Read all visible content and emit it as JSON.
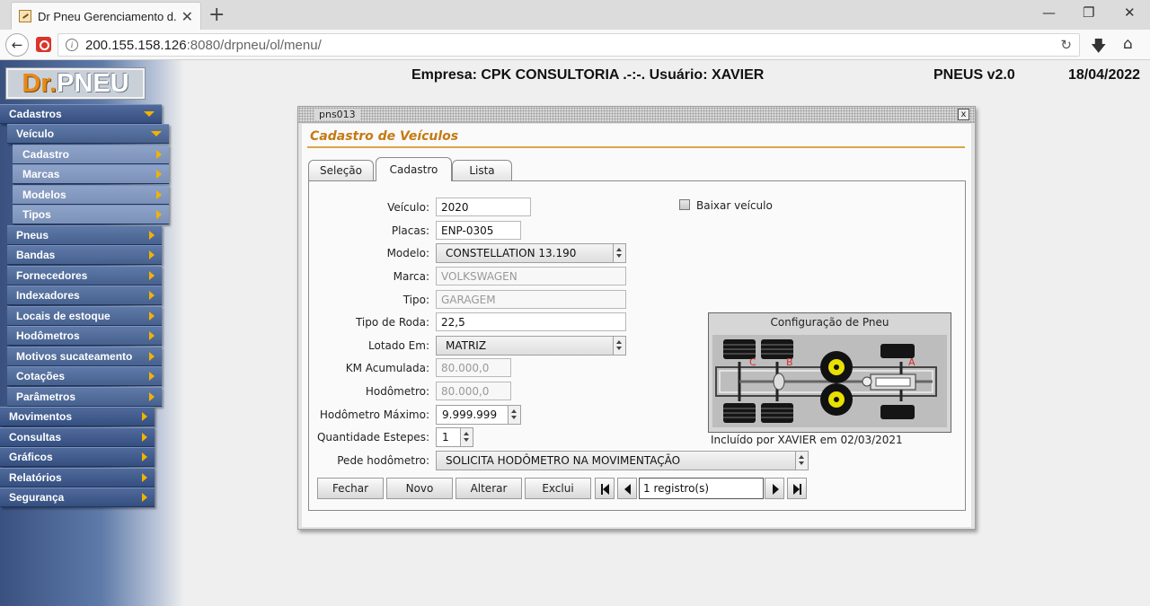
{
  "browser": {
    "tab_title": "Dr Pneu Gerenciamento d...",
    "tab_close": "✕",
    "new_tab": "+",
    "url_host": "200.155.158.126",
    "url_rest": ":8080/drpneu/ol/menu/",
    "window_controls": [
      "—",
      "❐",
      "✕"
    ]
  },
  "header": {
    "logo_dr": "Dr.",
    "logo_pneu": "PNEU",
    "company_user": "Empresa: CPK CONSULTORIA .-:-. Usuário: XAVIER",
    "version": "PNEUS v2.0",
    "date": "18/04/2022"
  },
  "menu": {
    "items": [
      {
        "label": "Cadastros",
        "level": 1,
        "expanded": true
      },
      {
        "label": "Veículo",
        "level": 2,
        "expanded": true
      },
      {
        "label": "Cadastro",
        "level": 3
      },
      {
        "label": "Marcas",
        "level": 3
      },
      {
        "label": "Modelos",
        "level": 3
      },
      {
        "label": "Tipos",
        "level": 3
      },
      {
        "label": "Pneus",
        "level": 2
      },
      {
        "label": "Bandas",
        "level": 2
      },
      {
        "label": "Fornecedores",
        "level": 2
      },
      {
        "label": "Indexadores",
        "level": 2
      },
      {
        "label": "Locais de estoque",
        "level": 2
      },
      {
        "label": "Hodômetros",
        "level": 2
      },
      {
        "label": "Motivos sucateamento",
        "level": 2
      },
      {
        "label": "Cotações",
        "level": 2
      },
      {
        "label": "Parâmetros",
        "level": 2
      },
      {
        "label": "Movimentos",
        "level": 1
      },
      {
        "label": "Consultas",
        "level": 1
      },
      {
        "label": "Gráficos",
        "level": 1
      },
      {
        "label": "Relatórios",
        "level": 1
      },
      {
        "label": "Segurança",
        "level": 1
      }
    ]
  },
  "window": {
    "id": "pns013",
    "close": "x",
    "title": "Cadastro de Veículos",
    "tabs": [
      "Seleção",
      "Cadastro",
      "Lista"
    ],
    "active_tab": "Cadastro"
  },
  "form": {
    "veiculo_label": "Veículo:",
    "veiculo": "2020",
    "placas_label": "Placas:",
    "placas": "ENP-0305",
    "modelo_label": "Modelo:",
    "modelo": "CONSTELLATION 13.190",
    "marca_label": "Marca:",
    "marca": "VOLKSWAGEN",
    "tipo_label": "Tipo:",
    "tipo": "GARAGEM",
    "tipo_roda_label": "Tipo de Roda:",
    "tipo_roda": "22,5",
    "lotado_label": "Lotado Em:",
    "lotado": "MATRIZ",
    "km_label": "KM Acumulada:",
    "km": "80.000,0",
    "hodometro_label": "Hodômetro:",
    "hodometro": "80.000,0",
    "hod_max_label": "Hodômetro Máximo:",
    "hod_max": "9.999.999",
    "estepes_label": "Quantidade Estepes:",
    "estepes": "1",
    "pede_hod_label": "Pede hodômetro:",
    "pede_hod": "SOLICITA HODÔMETRO NA MOVIMENTAÇÃO",
    "baixar_label": "Baixar veículo",
    "config_title": "Configuração de Pneu",
    "config_markers": [
      "C",
      "B",
      "A"
    ],
    "included": "Incluído por XAVIER em 02/03/2021"
  },
  "buttons": {
    "fechar": "Fechar",
    "novo": "Novo",
    "alterar": "Alterar",
    "excluir": "Exclui",
    "registros": "1 registro(s)"
  },
  "colors": {
    "menu_blue": "#344f80",
    "menu_arrow": "#f2b200",
    "title_orange": "#c47a12",
    "tire_yellow": "#e8e000"
  }
}
